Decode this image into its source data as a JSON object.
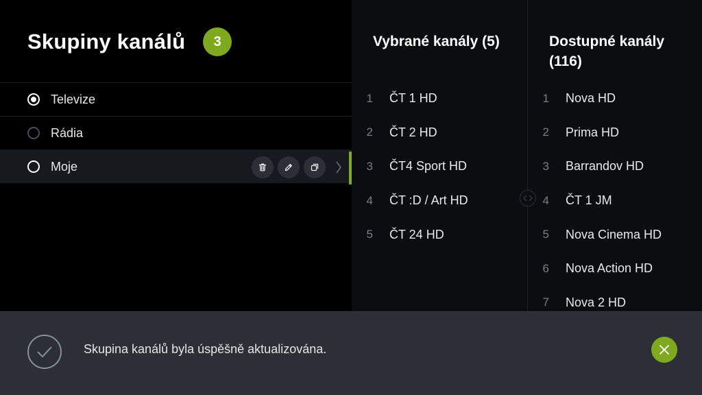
{
  "header": {
    "title": "Skupiny kanálů",
    "count": "3"
  },
  "groups": [
    {
      "label": "Televize",
      "state": "checked"
    },
    {
      "label": "Rádia",
      "state": "unchecked"
    },
    {
      "label": "Moje",
      "state": "unchecked"
    }
  ],
  "row_actions": {
    "icons": [
      "trash-icon",
      "pencil-icon",
      "copy-icon",
      "chevron-right-icon"
    ]
  },
  "selected_channels": {
    "title": "Vybrané kanály (5)",
    "items": [
      {
        "num": "1",
        "name": "ČT 1 HD"
      },
      {
        "num": "2",
        "name": "ČT 2 HD"
      },
      {
        "num": "3",
        "name": "ČT4 Sport HD"
      },
      {
        "num": "4",
        "name": "ČT :D / Art HD"
      },
      {
        "num": "5",
        "name": "ČT 24 HD"
      }
    ]
  },
  "available_channels": {
    "title": "Dostupné kanály (116)",
    "items": [
      {
        "num": "1",
        "name": "Nova HD"
      },
      {
        "num": "2",
        "name": "Prima HD"
      },
      {
        "num": "3",
        "name": "Barrandov HD"
      },
      {
        "num": "4",
        "name": "ČT 1 JM"
      },
      {
        "num": "5",
        "name": "Nova Cinema HD"
      },
      {
        "num": "6",
        "name": "Nova Action HD"
      },
      {
        "num": "7",
        "name": "Nova 2 HD"
      }
    ]
  },
  "toast": {
    "message": "Skupina kanálů byla úspěšně aktualizována."
  },
  "colors": {
    "accent": "#7fa91e",
    "background": "#000000",
    "panel": "#0b0d11",
    "toast": "#2c3036"
  }
}
